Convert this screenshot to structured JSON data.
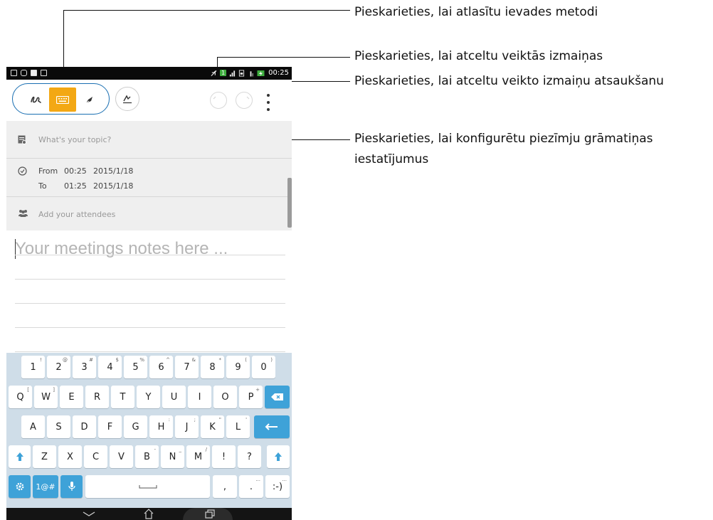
{
  "callouts": {
    "input_method": "Pieskarieties, lai atlasītu ievades metodi",
    "undo": "Pieskarieties, lai atceltu veiktās izmaiņas",
    "redo": "Pieskarieties, lai atceltu veikto izmaiņu atsaukšanu",
    "settings_line1": "Pieskarieties, lai konfigurētu piezīmju grāmatiņas",
    "settings_line2": "iestatījumus"
  },
  "status_bar": {
    "time": "00:25",
    "sim_badge": "1"
  },
  "toolbar": {
    "modes": [
      "handwriting",
      "keyboard",
      "pen"
    ],
    "active_mode": "keyboard",
    "icons": [
      "handwriting-icon",
      "keyboard-icon",
      "pen-icon",
      "draw-icon",
      "undo-icon",
      "redo-icon",
      "more-icon"
    ]
  },
  "form": {
    "topic_placeholder": "What's your topic?",
    "from_label": "From",
    "from_time": "00:25",
    "from_date": "2015/1/18",
    "to_label": "To",
    "to_time": "01:25",
    "to_date": "2015/1/18",
    "attendees_placeholder": "Add your attendees"
  },
  "notes": {
    "placeholder": "Your meetings notes here ..."
  },
  "keyboard": {
    "row1": [
      [
        "1",
        "!"
      ],
      [
        "2",
        "@"
      ],
      [
        "3",
        "#"
      ],
      [
        "4",
        "$"
      ],
      [
        "5",
        "%"
      ],
      [
        "6",
        "^"
      ],
      [
        "7",
        "&"
      ],
      [
        "8",
        "*"
      ],
      [
        "9",
        "("
      ],
      [
        "0",
        ")"
      ]
    ],
    "row2": [
      [
        "Q",
        "["
      ],
      [
        "W",
        "]"
      ],
      [
        "E",
        ""
      ],
      [
        "R",
        ""
      ],
      [
        "T",
        ""
      ],
      [
        "Y",
        ""
      ],
      [
        "U",
        ""
      ],
      [
        "I",
        ""
      ],
      [
        "O",
        ""
      ],
      [
        "P",
        "+"
      ]
    ],
    "row3": [
      [
        "A",
        ""
      ],
      [
        "S",
        ""
      ],
      [
        "D",
        ""
      ],
      [
        "F",
        ""
      ],
      [
        "G",
        ""
      ],
      [
        "H",
        ":"
      ],
      [
        "J",
        ";"
      ],
      [
        "K",
        "\""
      ],
      [
        "L",
        "'"
      ]
    ],
    "row4": [
      [
        "Z",
        ""
      ],
      [
        "X",
        ""
      ],
      [
        "C",
        ""
      ],
      [
        "V",
        ""
      ],
      [
        "B",
        "-"
      ],
      [
        "N",
        "_"
      ],
      [
        "M",
        "/"
      ],
      [
        "!",
        ""
      ],
      [
        "?",
        ""
      ]
    ],
    "symbols_label": "1@#",
    "comma": ",",
    "period": ".",
    "smiley": ":-)"
  },
  "colors": {
    "accent_blue": "#3ea2d8",
    "active_mode": "#f3a814",
    "keyboard_bg": "#cfdde8",
    "form_bg": "#efefef"
  }
}
